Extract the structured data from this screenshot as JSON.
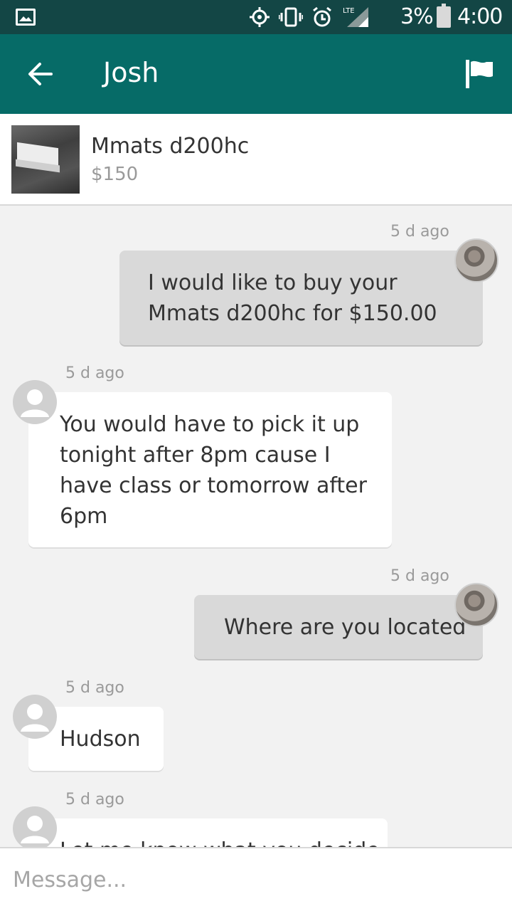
{
  "status_bar": {
    "battery_pct": "3%",
    "time": "4:00",
    "network": "LTE"
  },
  "header": {
    "title": "Josh"
  },
  "listing": {
    "title": "Mmats d200hc",
    "price": "$150"
  },
  "messages": [
    {
      "timestamp": "5 d ago",
      "text_lines": [
        "I would like to buy your",
        "Mmats d200hc for $150.00"
      ]
    },
    {
      "timestamp": "5 d ago",
      "text_lines": [
        "You would have to pick it up",
        "tonight after 8pm cause I",
        "have class or tomorrow after",
        "6pm"
      ]
    },
    {
      "timestamp": "5 d ago",
      "text_lines": [
        "Where are you located"
      ]
    },
    {
      "timestamp": "5 d ago",
      "text_lines": [
        "Hudson"
      ]
    },
    {
      "timestamp": "5 d ago",
      "text_lines": [
        "Let me know what you decide"
      ]
    }
  ],
  "composer": {
    "placeholder": "Message..."
  },
  "colors": {
    "status_bar": "#134645",
    "app_bar": "#066b67",
    "background": "#f2f2f2"
  }
}
